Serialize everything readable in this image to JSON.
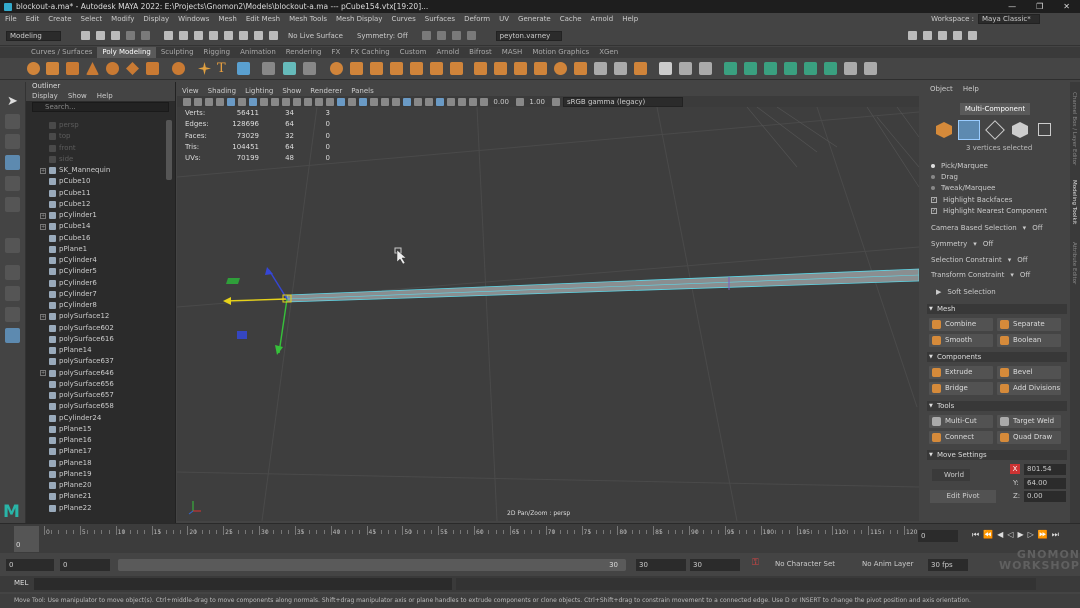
{
  "window": {
    "title": "blockout-a.ma* - Autodesk MAYA 2022: E:\\Projects\\Gnomon2\\Models\\blockout-a.ma  ---  pCube154.vtx[19:20]...",
    "min": "—",
    "max": "❐",
    "close": "✕"
  },
  "menubar": {
    "items": [
      "File",
      "Edit",
      "Create",
      "Select",
      "Modify",
      "Display",
      "Windows",
      "Mesh",
      "Edit Mesh",
      "Mesh Tools",
      "Mesh Display",
      "Curves",
      "Surfaces",
      "Deform",
      "UV",
      "Generate",
      "Cache",
      "Arnold",
      "Help"
    ],
    "workspace_label": "Workspace :",
    "workspace_value": "Maya Classic*"
  },
  "statusline": {
    "mode": "Modeling",
    "live": "No Live Surface",
    "symmetry": "Symmetry: Off",
    "user": "peyton.varney"
  },
  "shelf_tabs": [
    "Curves / Surfaces",
    "Poly Modeling",
    "Sculpting",
    "Rigging",
    "Animation",
    "Rendering",
    "FX",
    "FX Caching",
    "Custom",
    "Arnold",
    "Bifrost",
    "MASH",
    "Motion Graphics",
    "XGen"
  ],
  "shelf_active": "Poly Modeling",
  "outliner": {
    "title": "Outliner",
    "menu": [
      "Display",
      "Show",
      "Help"
    ],
    "search_placeholder": "Search...",
    "items": [
      {
        "name": "persp",
        "dim": true,
        "expand": false
      },
      {
        "name": "top",
        "dim": true,
        "expand": false
      },
      {
        "name": "front",
        "dim": true,
        "expand": false
      },
      {
        "name": "side",
        "dim": true,
        "expand": false
      },
      {
        "name": "SK_Mannequin",
        "expand": true
      },
      {
        "name": "pCube10",
        "expand": false
      },
      {
        "name": "pCube11",
        "expand": false
      },
      {
        "name": "pCube12",
        "expand": false
      },
      {
        "name": "pCylinder1",
        "expand": true
      },
      {
        "name": "pCube14",
        "expand": true
      },
      {
        "name": "pCube16",
        "expand": false
      },
      {
        "name": "pPlane1",
        "expand": false
      },
      {
        "name": "pCylinder4",
        "expand": false
      },
      {
        "name": "pCylinder5",
        "expand": false
      },
      {
        "name": "pCylinder6",
        "expand": false
      },
      {
        "name": "pCylinder7",
        "expand": false
      },
      {
        "name": "pCylinder8",
        "expand": false
      },
      {
        "name": "polySurface12",
        "expand": true
      },
      {
        "name": "polySurface602",
        "expand": false
      },
      {
        "name": "polySurface616",
        "expand": false
      },
      {
        "name": "pPlane14",
        "expand": false
      },
      {
        "name": "polySurface637",
        "expand": false
      },
      {
        "name": "polySurface646",
        "expand": true
      },
      {
        "name": "polySurface656",
        "expand": false
      },
      {
        "name": "polySurface657",
        "expand": false
      },
      {
        "name": "polySurface658",
        "expand": false
      },
      {
        "name": "pCylinder24",
        "expand": false
      },
      {
        "name": "pPlane15",
        "expand": false
      },
      {
        "name": "pPlane16",
        "expand": false
      },
      {
        "name": "pPlane17",
        "expand": false
      },
      {
        "name": "pPlane18",
        "expand": false
      },
      {
        "name": "pPlane19",
        "expand": false
      },
      {
        "name": "pPlane20",
        "expand": false
      },
      {
        "name": "pPlane21",
        "expand": false
      },
      {
        "name": "pPlane22",
        "expand": false
      }
    ]
  },
  "viewport": {
    "menu": [
      "View",
      "Shading",
      "Lighting",
      "Show",
      "Renderer",
      "Panels"
    ],
    "exposure": "0.00",
    "gamma": "1.00",
    "colorspace": "sRGB gamma (legacy)",
    "footer": "2D Pan/Zoom : persp",
    "hud": [
      {
        "label": "Verts:",
        "a": "56411",
        "b": "34",
        "c": "3"
      },
      {
        "label": "Edges:",
        "a": "128696",
        "b": "64",
        "c": "0"
      },
      {
        "label": "Faces:",
        "a": "73029",
        "b": "32",
        "c": "0"
      },
      {
        "label": "Tris:",
        "a": "104451",
        "b": "64",
        "c": "0"
      },
      {
        "label": "UVs:",
        "a": "70199",
        "b": "48",
        "c": "0"
      }
    ]
  },
  "timeline": {
    "ticks": [
      "0",
      "5",
      "10",
      "15",
      "20",
      "25",
      "30",
      "35",
      "40",
      "45",
      "50",
      "55",
      "60",
      "65",
      "70",
      "75",
      "80",
      "85",
      "90",
      "95",
      "100",
      "105",
      "110",
      "115",
      "120"
    ],
    "current": "0",
    "field": "0"
  },
  "range": {
    "start": "0",
    "inner_start": "0",
    "inner_end": "30",
    "end1": "30",
    "end2": "30",
    "char_set": "No Character Set",
    "anim_layer": "No Anim Layer",
    "fps": "30 fps"
  },
  "cmdline": {
    "label": "MEL"
  },
  "helpline": "Move Tool: Use manipulator to move object(s). Ctrl+middle-drag to move components along normals. Shift+drag manipulator axis or plane handles to extrude components or clone objects. Ctrl+Shift+drag to constrain movement to a connected edge. Use D or INSERT to change the pivot position and axis orientation.",
  "watermark": "GNOMON WORKSHOP",
  "rpanel": {
    "menu": [
      "Object",
      "Help"
    ],
    "mode": "Multi-Component",
    "selected": "3 vertices selected",
    "pick_opts": [
      "Pick/Marquee",
      "Drag",
      "Tweak/Marquee"
    ],
    "checks": [
      "Highlight Backfaces",
      "Highlight Nearest Component"
    ],
    "camera_sel": "Camera Based Selection",
    "camera_sel_val": "Off",
    "symmetry": "Symmetry",
    "symmetry_val": "Off",
    "sel_constraint": "Selection Constraint",
    "sel_constraint_val": "Off",
    "xform_constraint": "Transform Constraint",
    "xform_constraint_val": "Off",
    "soft_sel": "Soft Selection",
    "mesh": "Mesh",
    "mesh_btns": [
      "Combine",
      "Separate",
      "Smooth",
      "Boolean"
    ],
    "components": "Components",
    "comp_btns": [
      "Extrude",
      "Bevel",
      "Bridge",
      "Add Divisions"
    ],
    "tools": "Tools",
    "tool_btns": [
      "Multi-Cut",
      "Target Weld",
      "Connect",
      "Quad Draw"
    ],
    "move_settings": "Move Settings",
    "space": "World",
    "x": "801.54",
    "y": "64.00",
    "z": "0.00",
    "edit_pivot": "Edit Pivot"
  },
  "side_tabs": [
    "Channel Box / Layer Editor",
    "Modeling Toolkit",
    "Attribute Editor"
  ]
}
